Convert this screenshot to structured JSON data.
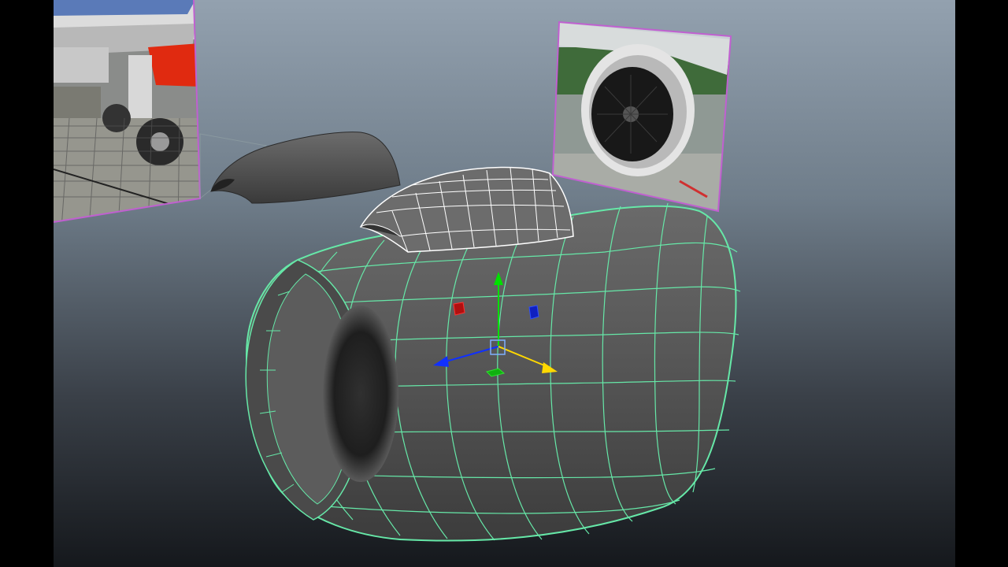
{
  "app": {
    "name": "3D viewport",
    "selection_color": "#66e8a8",
    "image_plane_border_color": "#c060d0"
  },
  "scene": {
    "objects": [
      {
        "name": "engine-nacelle",
        "icon": "wireframe-mesh",
        "selected": true
      },
      {
        "name": "nacelle-top-cowl",
        "icon": "wireframe-mesh",
        "selected": false
      },
      {
        "name": "shaded-cowl-shell",
        "icon": "mesh",
        "selected": false
      },
      {
        "name": "reference-image-landing-gear",
        "icon": "image-plane",
        "selected": false
      },
      {
        "name": "reference-image-engine-front",
        "icon": "image-plane",
        "selected": false
      }
    ]
  },
  "gizmo": {
    "tool": "move-tool",
    "axis_colors": {
      "x": "#ffd800",
      "y": "#00e000",
      "z": "#1030ff",
      "center": "#7fb0ff"
    }
  }
}
